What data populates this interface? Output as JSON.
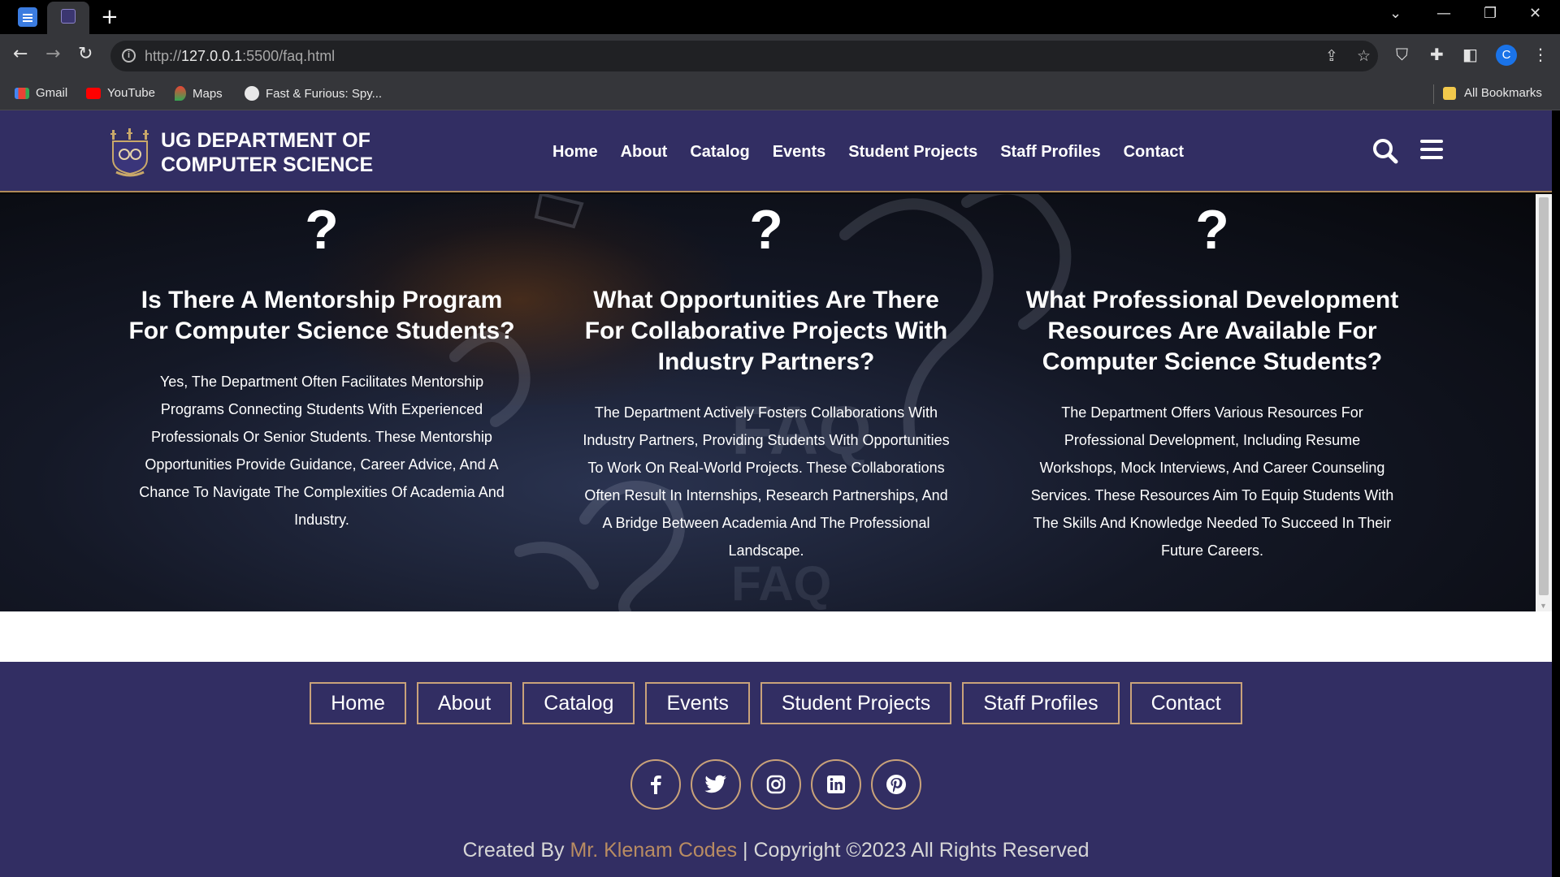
{
  "browser": {
    "url_prefix": "http://",
    "url_host": "127.0.0.1",
    "url_rest": ":5500/faq.html",
    "bookmarks": [
      "Gmail",
      "YouTube",
      "Maps",
      "Fast & Furious: Spy..."
    ],
    "all_bookmarks": "All Bookmarks",
    "profile_initial": "C"
  },
  "header": {
    "brand_line1": "UG DEPARTMENT OF",
    "brand_line2": "COMPUTER SCIENCE",
    "nav": [
      "Home",
      "About",
      "Catalog",
      "Events",
      "Student Projects",
      "Staff Profiles",
      "Contact"
    ]
  },
  "faq": {
    "items": [
      {
        "icon": "?",
        "question": "Is There A Mentorship Program For Computer Science Students?",
        "answer": "Yes, The Department Often Facilitates Mentorship Programs Connecting Students With Experienced Professionals Or Senior Students. These Mentorship Opportunities Provide Guidance, Career Advice, And A Chance To Navigate The Complexities Of Academia And Industry."
      },
      {
        "icon": "?",
        "question": "What Opportunities Are There For Collaborative Projects With Industry Partners?",
        "answer": "The Department Actively Fosters Collaborations With Industry Partners, Providing Students With Opportunities To Work On Real-World Projects. These Collaborations Often Result In Internships, Research Partnerships, And A Bridge Between Academia And The Professional Landscape."
      },
      {
        "icon": "?",
        "question": "What Professional Development Resources Are Available For Computer Science Students?",
        "answer": "The Department Offers Various Resources For Professional Development, Including Resume Workshops, Mock Interviews, And Career Counseling Services. These Resources Aim To Equip Students With The Skills And Knowledge Needed To Succeed In Their Future Careers."
      }
    ]
  },
  "footer": {
    "nav": [
      "Home",
      "About",
      "Catalog",
      "Events",
      "Student Projects",
      "Staff Profiles",
      "Contact"
    ],
    "social": [
      "facebook-icon",
      "twitter-icon",
      "instagram-icon",
      "linkedin-icon",
      "pinterest-icon"
    ],
    "created_by": "Created By",
    "author": "Mr. Klenam Codes",
    "copyright": "| Copyright ©2023 All Rights Reserved"
  },
  "colors": {
    "brand_purple": "#322e63",
    "accent_gold": "#c9a27a",
    "author_link": "#b98c62"
  }
}
